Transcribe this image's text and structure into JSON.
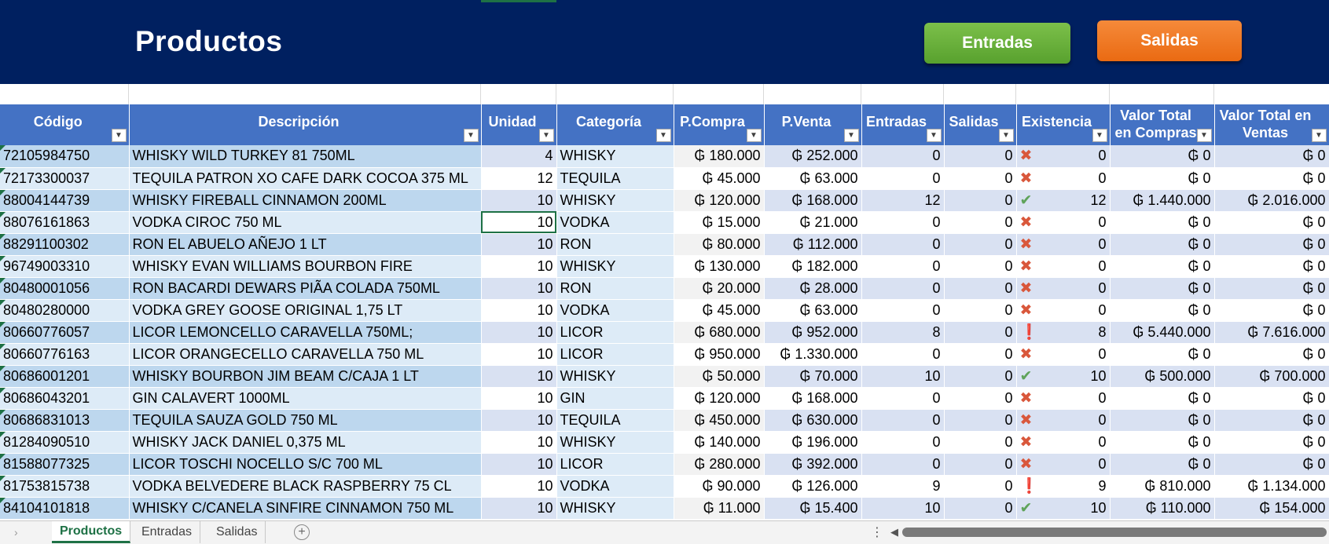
{
  "header": {
    "title": "Productos",
    "entradas_button": "Entradas",
    "salidas_button": "Salidas"
  },
  "columns": [
    "Código",
    "Descripción",
    "Unidad",
    "Categoría",
    "P.Compra",
    "P.Venta",
    "Entradas",
    "Salidas",
    "Existencia",
    "Valor Total en Compras",
    "Valor Total en Ventas"
  ],
  "status_icons": {
    "x": "red-x-icon",
    "ok": "green-check-icon",
    "warn": "yellow-exclamation-icon"
  },
  "rows": [
    {
      "codigo": "72105984750",
      "descripcion": "WHISKY WILD TURKEY 81 750ML",
      "unidad": "4",
      "categoria": "WHISKY",
      "pcompra": "₲ 180.000",
      "pventa": "₲ 252.000",
      "entradas": "0",
      "salidas": "0",
      "status": "x",
      "existencia": "0",
      "vcompras": "₲ 0",
      "vventas": "₲ 0"
    },
    {
      "codigo": "72173300037",
      "descripcion": "TEQUILA PATRON XO CAFE DARK COCOA 375 ML",
      "unidad": "12",
      "categoria": "TEQUILA",
      "pcompra": "₲ 45.000",
      "pventa": "₲ 63.000",
      "entradas": "0",
      "salidas": "0",
      "status": "x",
      "existencia": "0",
      "vcompras": "₲ 0",
      "vventas": "₲ 0"
    },
    {
      "codigo": "88004144739",
      "descripcion": "WHISKY FIREBALL CINNAMON 200ML",
      "unidad": "10",
      "categoria": "WHISKY",
      "pcompra": "₲ 120.000",
      "pventa": "₲ 168.000",
      "entradas": "12",
      "salidas": "0",
      "status": "ok",
      "existencia": "12",
      "vcompras": "₲ 1.440.000",
      "vventas": "₲ 2.016.000"
    },
    {
      "codigo": "88076161863",
      "descripcion": "VODKA CIROC 750 ML",
      "unidad": "10",
      "categoria": "VODKA",
      "pcompra": "₲ 15.000",
      "pventa": "₲ 21.000",
      "entradas": "0",
      "salidas": "0",
      "status": "x",
      "existencia": "0",
      "vcompras": "₲ 0",
      "vventas": "₲ 0"
    },
    {
      "codigo": "88291100302",
      "descripcion": "RON EL ABUELO AÑEJO 1 LT",
      "unidad": "10",
      "categoria": "RON",
      "pcompra": "₲ 80.000",
      "pventa": "₲ 112.000",
      "entradas": "0",
      "salidas": "0",
      "status": "x",
      "existencia": "0",
      "vcompras": "₲ 0",
      "vventas": "₲ 0"
    },
    {
      "codigo": "96749003310",
      "descripcion": "WHISKY EVAN WILLIAMS BOURBON FIRE",
      "unidad": "10",
      "categoria": "WHISKY",
      "pcompra": "₲ 130.000",
      "pventa": "₲ 182.000",
      "entradas": "0",
      "salidas": "0",
      "status": "x",
      "existencia": "0",
      "vcompras": "₲ 0",
      "vventas": "₲ 0"
    },
    {
      "codigo": "80480001056",
      "descripcion": "RON BACARDI DEWARS PIÃA COLADA 750ML",
      "unidad": "10",
      "categoria": "RON",
      "pcompra": "₲ 20.000",
      "pventa": "₲ 28.000",
      "entradas": "0",
      "salidas": "0",
      "status": "x",
      "existencia": "0",
      "vcompras": "₲ 0",
      "vventas": "₲ 0"
    },
    {
      "codigo": "80480280000",
      "descripcion": "VODKA GREY GOOSE ORIGINAL 1,75 LT",
      "unidad": "10",
      "categoria": "VODKA",
      "pcompra": "₲ 45.000",
      "pventa": "₲ 63.000",
      "entradas": "0",
      "salidas": "0",
      "status": "x",
      "existencia": "0",
      "vcompras": "₲ 0",
      "vventas": "₲ 0"
    },
    {
      "codigo": "80660776057",
      "descripcion": "LICOR LEMONCELLO CARAVELLA 750ML;",
      "unidad": "10",
      "categoria": "LICOR",
      "pcompra": "₲ 680.000",
      "pventa": "₲ 952.000",
      "entradas": "8",
      "salidas": "0",
      "status": "warn",
      "existencia": "8",
      "vcompras": "₲ 5.440.000",
      "vventas": "₲ 7.616.000"
    },
    {
      "codigo": "80660776163",
      "descripcion": "LICOR ORANGECELLO CARAVELLA 750 ML",
      "unidad": "10",
      "categoria": "LICOR",
      "pcompra": "₲ 950.000",
      "pventa": "₲ 1.330.000",
      "entradas": "0",
      "salidas": "0",
      "status": "x",
      "existencia": "0",
      "vcompras": "₲ 0",
      "vventas": "₲ 0"
    },
    {
      "codigo": "80686001201",
      "descripcion": "WHISKY BOURBON JIM BEAM C/CAJA 1 LT",
      "unidad": "10",
      "categoria": "WHISKY",
      "pcompra": "₲ 50.000",
      "pventa": "₲ 70.000",
      "entradas": "10",
      "salidas": "0",
      "status": "ok",
      "existencia": "10",
      "vcompras": "₲ 500.000",
      "vventas": "₲ 700.000"
    },
    {
      "codigo": "80686043201",
      "descripcion": "GIN CALAVERT 1000ML",
      "unidad": "10",
      "categoria": "GIN",
      "pcompra": "₲ 120.000",
      "pventa": "₲ 168.000",
      "entradas": "0",
      "salidas": "0",
      "status": "x",
      "existencia": "0",
      "vcompras": "₲ 0",
      "vventas": "₲ 0"
    },
    {
      "codigo": "80686831013",
      "descripcion": "TEQUILA SAUZA GOLD 750 ML",
      "unidad": "10",
      "categoria": "TEQUILA",
      "pcompra": "₲ 450.000",
      "pventa": "₲ 630.000",
      "entradas": "0",
      "salidas": "0",
      "status": "x",
      "existencia": "0",
      "vcompras": "₲ 0",
      "vventas": "₲ 0"
    },
    {
      "codigo": "81284090510",
      "descripcion": "WHISKY JACK DANIEL 0,375 ML",
      "unidad": "10",
      "categoria": "WHISKY",
      "pcompra": "₲ 140.000",
      "pventa": "₲ 196.000",
      "entradas": "0",
      "salidas": "0",
      "status": "x",
      "existencia": "0",
      "vcompras": "₲ 0",
      "vventas": "₲ 0"
    },
    {
      "codigo": "81588077325",
      "descripcion": "LICOR TOSCHI NOCELLO S/C 700 ML",
      "unidad": "10",
      "categoria": "LICOR",
      "pcompra": "₲ 280.000",
      "pventa": "₲ 392.000",
      "entradas": "0",
      "salidas": "0",
      "status": "x",
      "existencia": "0",
      "vcompras": "₲ 0",
      "vventas": "₲ 0"
    },
    {
      "codigo": "81753815738",
      "descripcion": "VODKA BELVEDERE BLACK RASPBERRY 75 CL",
      "unidad": "10",
      "categoria": "VODKA",
      "pcompra": "₲ 90.000",
      "pventa": "₲ 126.000",
      "entradas": "9",
      "salidas": "0",
      "status": "warn",
      "existencia": "9",
      "vcompras": "₲ 810.000",
      "vventas": "₲ 1.134.000"
    },
    {
      "codigo": "84104101818",
      "descripcion": "WHISKY C/CANELA SINFIRE CINNAMON 750 ML",
      "unidad": "10",
      "categoria": "WHISKY",
      "pcompra": "₲ 11.000",
      "pventa": "₲ 15.400",
      "entradas": "10",
      "salidas": "0",
      "status": "ok",
      "existencia": "10",
      "vcompras": "₲ 110.000",
      "vventas": "₲ 154.000"
    }
  ],
  "sheet_tabs": [
    "Productos",
    "Entradas",
    "Salidas"
  ],
  "colors": {
    "banner": "#002060",
    "header": "#4472c4",
    "entradas": "#5fa83a",
    "salidas": "#f07a22",
    "active_tab": "#1e7145"
  }
}
